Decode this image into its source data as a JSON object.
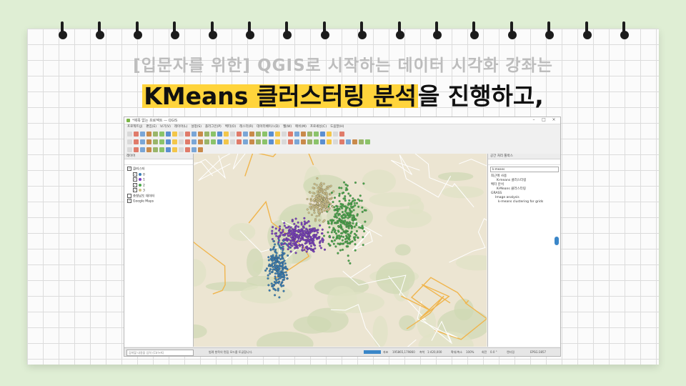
{
  "slide": {
    "title_line1": "[입문자를 위한] QGIS로 시작하는 데이터 시각화 강좌는",
    "title_highlight": "KMeans 클러스터링 분석",
    "title_rest": "을 진행하고,",
    "highlight_color": "#ffd43b"
  },
  "qgis": {
    "window_title": "*제목 없는 프로젝트 — QGIS",
    "menus": [
      "프로젝트(J)",
      "편집(E)",
      "보기(V)",
      "레이어(L)",
      "설정(S)",
      "플러그인(P)",
      "벡터(O)",
      "래스터(R)",
      "데이터베이스(D)",
      "웹(W)",
      "메쉬(M)",
      "프로세싱(C)",
      "도움말(H)"
    ],
    "left_panel_title": "레이어",
    "layers": [
      {
        "name": "클러스터",
        "checked": true,
        "color": ""
      },
      {
        "name": "0",
        "checked": true,
        "color": "#3a7fb5"
      },
      {
        "name": "1",
        "checked": true,
        "color": "#7a3fbf"
      },
      {
        "name": "2",
        "checked": true,
        "color": "#4aa84a"
      },
      {
        "name": "3",
        "checked": true,
        "color": "#cfc28a"
      },
      {
        "name": "충청남도 데이터",
        "checked": false,
        "color": ""
      },
      {
        "name": "Google Maps",
        "checked": true,
        "color": ""
      }
    ],
    "right_panel_title": "공간 처리 툴박스",
    "search_value": "k-means",
    "tree": [
      "최근에 사용",
      "K-means 클러스터링",
      "벡터 분석",
      "K-Means 클러스터링",
      "GRASS",
      "Image analysis",
      "k-means clustering for grids"
    ],
    "status": {
      "locator_placeholder": "검색할 내용을 입력 (Ctrl+K)",
      "message": "범례 항목의 편집 모드를 토글합니다.",
      "coord_label": "좌표",
      "coord_value": "195865,179860",
      "scale_label": "축척",
      "scale_value": "1:420,000",
      "magnifier_label": "확대/축소",
      "magnifier_value": "100%",
      "rotation_label": "회전",
      "rotation_value": "0.0 °",
      "render_label": "렌더링",
      "crs": "EPSG:3857"
    },
    "cluster_colors": {
      "c0": "#3a7fb5",
      "c1": "#7a3fbf",
      "c2": "#4aa84a",
      "c3": "#cfc28a"
    }
  }
}
